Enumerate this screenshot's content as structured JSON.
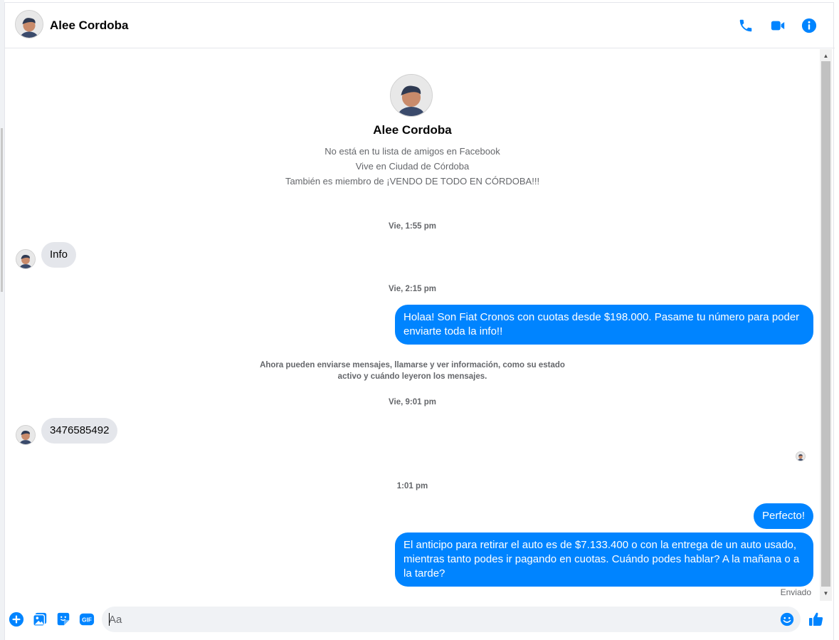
{
  "header": {
    "contact_name": "Alee Cordoba"
  },
  "profile": {
    "name": "Alee Cordoba",
    "lines": [
      "No está en tu lista de amigos en Facebook",
      "Vive en Ciudad de Córdoba",
      "También es miembro de ¡VENDO DE TODO EN CÓRDOBA!!!"
    ]
  },
  "messages": {
    "ts1": "Vie, 1:55 pm",
    "in1": "Info",
    "ts2": "Vie, 2:15 pm",
    "out1": "Holaa! Son Fiat Cronos con cuotas desde $198.000. Pasame tu número para poder enviarte toda la info!!",
    "system_note": "Ahora pueden enviarse mensajes, llamarse y ver información, como su estado activo y cuándo leyeron los mensajes.",
    "ts3": "Vie, 9:01 pm",
    "in2": "3476585492",
    "ts4": "1:01 pm",
    "out2": "Perfecto!",
    "out3": "El anticipo para retirar el auto es de $7.133.400 o con la entrega de un auto usado, mientras tanto podes ir pagando en cuotas. Cuándo podes hablar? A la mañana o a la tarde?",
    "status": "Enviado"
  },
  "composer": {
    "placeholder": "Aa"
  },
  "icons": {
    "header": [
      "phone-icon",
      "video-camera-icon",
      "info-icon"
    ],
    "composer": [
      "plus-icon",
      "image-icon",
      "sticker-icon",
      "gif-icon",
      "emoji-icon",
      "thumbs-up-icon"
    ],
    "gif_label": "GIF"
  },
  "colors": {
    "accent": "#0084ff",
    "incoming_bubble": "#e4e6eb",
    "muted_text": "#65676b"
  }
}
